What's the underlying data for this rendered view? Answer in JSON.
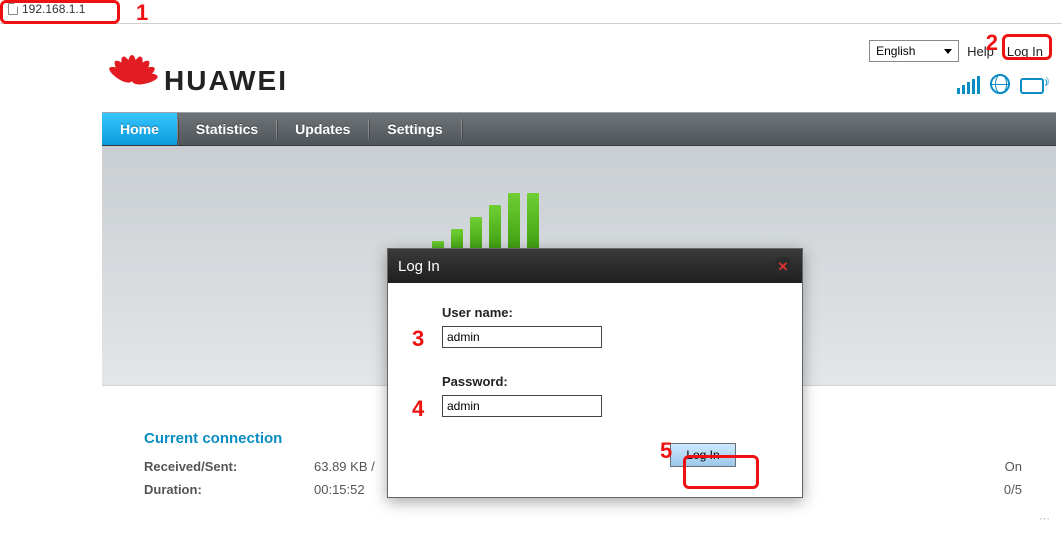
{
  "browser": {
    "url": "192.168.1.1"
  },
  "topbar": {
    "language_selected": "English",
    "help_label": "Help",
    "login_label": "Log In"
  },
  "brand": {
    "name": "HUAWEI"
  },
  "nav": {
    "items": [
      {
        "label": "Home",
        "active": true
      },
      {
        "label": "Statistics",
        "active": false
      },
      {
        "label": "Updates",
        "active": false
      },
      {
        "label": "Settings",
        "active": false
      }
    ]
  },
  "stats": {
    "title": "Current connection",
    "rows": [
      {
        "key": "Received/Sent:",
        "value_visible": "63.89 KB /",
        "right": "On"
      },
      {
        "key": "Duration:",
        "value_visible": "00:15:52",
        "right": "0/5"
      }
    ]
  },
  "modal": {
    "title": "Log In",
    "username_label": "User name:",
    "username_value": "admin",
    "password_label": "Password:",
    "password_value": "admin",
    "submit_label": "Log In"
  },
  "annotations": {
    "n1": "1",
    "n2": "2",
    "n3": "3",
    "n4": "4",
    "n5": "5"
  }
}
